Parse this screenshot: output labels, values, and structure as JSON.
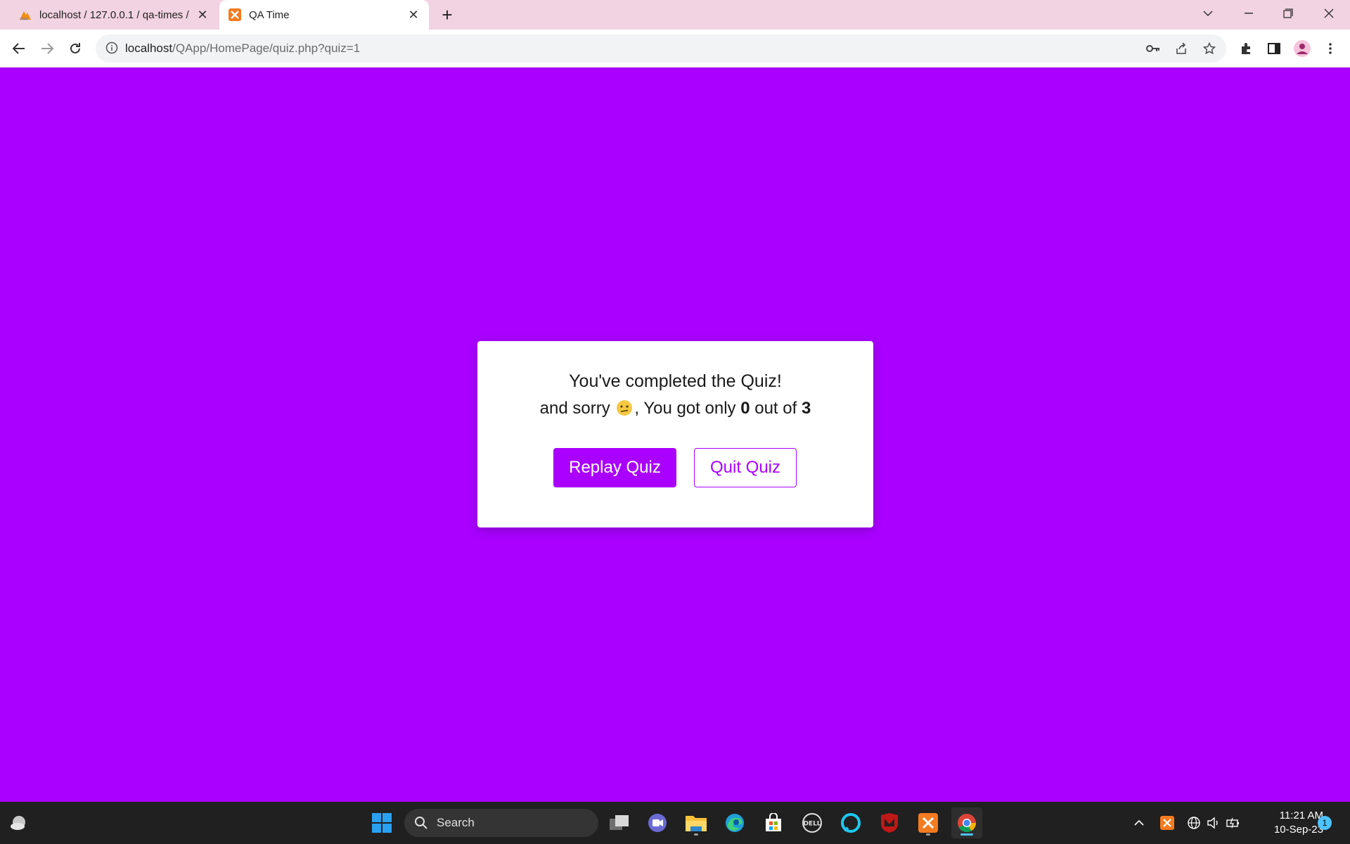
{
  "browser": {
    "tabs": [
      {
        "title": "localhost / 127.0.0.1 / qa-times /",
        "active": false,
        "icon": "phpmyadmin-icon"
      },
      {
        "title": "QA Time",
        "active": true,
        "icon": "xampp-icon"
      }
    ],
    "url_host": "localhost",
    "url_path": "/QApp/HomePage/quiz.php?quiz=1"
  },
  "result": {
    "heading": "You've completed the Quiz!",
    "prefix": "and sorry",
    "emoji": "confused-face",
    "middle": ", You got only",
    "score": "0",
    "out_of_label": "out of",
    "total": "3"
  },
  "buttons": {
    "replay": "Replay Quiz",
    "quit": "Quit Quiz"
  },
  "colors": {
    "page_background": "#a900ff",
    "accent": "#a900ff",
    "card_background": "#ffffff",
    "tabstrip": "#f2d3e1"
  },
  "taskbar": {
    "search_label": "Search",
    "time": "11:21 AM",
    "date": "10-Sep-23",
    "notification_count": "1"
  }
}
